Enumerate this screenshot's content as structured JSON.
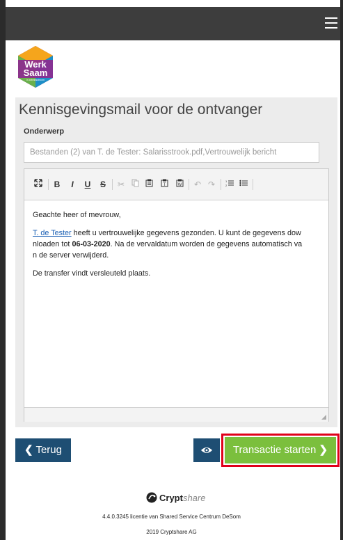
{
  "logo": {
    "line1": "Werk",
    "line2": "Saam",
    "tag": "in arbeidsstroom"
  },
  "panel": {
    "title": "Kennisgevingsmail voor de ontvanger",
    "subject_label": "Onderwerp",
    "subject_value": "Bestanden (2) van T. de Tester: Salarisstrook.pdf,Vertrouwelijk bericht"
  },
  "toolbar": {
    "bold": "B",
    "italic": "I",
    "underline": "U",
    "strike": "S"
  },
  "editor": {
    "greeting": "Geachte heer of mevrouw,",
    "sender_link": "T. de Tester",
    "line_a": " heeft u vertrouwelijke gegevens gezonden. U kunt de gegevens dow",
    "line_b_pre": "nloaden tot ",
    "date": "06-03-2020",
    "line_b_post": ". Na de vervaldatum worden de gegevens automatisch va",
    "line_c": "n de server verwijderd.",
    "transfer_note": "De transfer vindt versleuteld plaats."
  },
  "actions": {
    "back_label": "Terug",
    "start_label": "Transactie starten"
  },
  "footer": {
    "brand": "Crypt",
    "brand_share": "share",
    "license": "4.4.0.3245 licentie van Shared Service Centrum DeSom",
    "copyright": "2019 Cryptshare AG"
  },
  "colors": {
    "topbar": "#3d3d3d",
    "primary_button": "#1e4e73",
    "start_button": "#7bbf3d",
    "highlight": "#e0001a",
    "link": "#1a5fb4"
  }
}
